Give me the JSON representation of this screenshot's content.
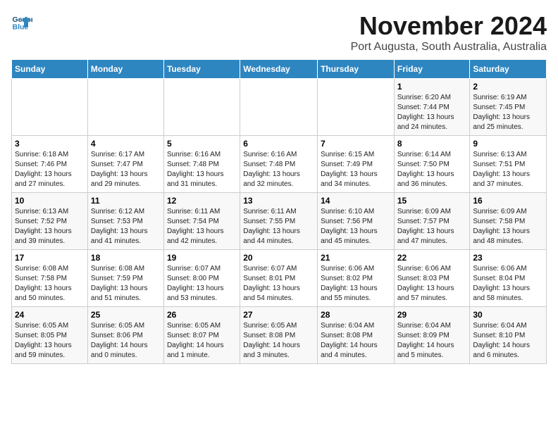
{
  "header": {
    "logo_line1": "General",
    "logo_line2": "Blue",
    "title": "November 2024",
    "subtitle": "Port Augusta, South Australia, Australia"
  },
  "weekdays": [
    "Sunday",
    "Monday",
    "Tuesday",
    "Wednesday",
    "Thursday",
    "Friday",
    "Saturday"
  ],
  "weeks": [
    [
      {
        "day": "",
        "info": ""
      },
      {
        "day": "",
        "info": ""
      },
      {
        "day": "",
        "info": ""
      },
      {
        "day": "",
        "info": ""
      },
      {
        "day": "",
        "info": ""
      },
      {
        "day": "1",
        "info": "Sunrise: 6:20 AM\nSunset: 7:44 PM\nDaylight: 13 hours\nand 24 minutes."
      },
      {
        "day": "2",
        "info": "Sunrise: 6:19 AM\nSunset: 7:45 PM\nDaylight: 13 hours\nand 25 minutes."
      }
    ],
    [
      {
        "day": "3",
        "info": "Sunrise: 6:18 AM\nSunset: 7:46 PM\nDaylight: 13 hours\nand 27 minutes."
      },
      {
        "day": "4",
        "info": "Sunrise: 6:17 AM\nSunset: 7:47 PM\nDaylight: 13 hours\nand 29 minutes."
      },
      {
        "day": "5",
        "info": "Sunrise: 6:16 AM\nSunset: 7:48 PM\nDaylight: 13 hours\nand 31 minutes."
      },
      {
        "day": "6",
        "info": "Sunrise: 6:16 AM\nSunset: 7:48 PM\nDaylight: 13 hours\nand 32 minutes."
      },
      {
        "day": "7",
        "info": "Sunrise: 6:15 AM\nSunset: 7:49 PM\nDaylight: 13 hours\nand 34 minutes."
      },
      {
        "day": "8",
        "info": "Sunrise: 6:14 AM\nSunset: 7:50 PM\nDaylight: 13 hours\nand 36 minutes."
      },
      {
        "day": "9",
        "info": "Sunrise: 6:13 AM\nSunset: 7:51 PM\nDaylight: 13 hours\nand 37 minutes."
      }
    ],
    [
      {
        "day": "10",
        "info": "Sunrise: 6:13 AM\nSunset: 7:52 PM\nDaylight: 13 hours\nand 39 minutes."
      },
      {
        "day": "11",
        "info": "Sunrise: 6:12 AM\nSunset: 7:53 PM\nDaylight: 13 hours\nand 41 minutes."
      },
      {
        "day": "12",
        "info": "Sunrise: 6:11 AM\nSunset: 7:54 PM\nDaylight: 13 hours\nand 42 minutes."
      },
      {
        "day": "13",
        "info": "Sunrise: 6:11 AM\nSunset: 7:55 PM\nDaylight: 13 hours\nand 44 minutes."
      },
      {
        "day": "14",
        "info": "Sunrise: 6:10 AM\nSunset: 7:56 PM\nDaylight: 13 hours\nand 45 minutes."
      },
      {
        "day": "15",
        "info": "Sunrise: 6:09 AM\nSunset: 7:57 PM\nDaylight: 13 hours\nand 47 minutes."
      },
      {
        "day": "16",
        "info": "Sunrise: 6:09 AM\nSunset: 7:58 PM\nDaylight: 13 hours\nand 48 minutes."
      }
    ],
    [
      {
        "day": "17",
        "info": "Sunrise: 6:08 AM\nSunset: 7:58 PM\nDaylight: 13 hours\nand 50 minutes."
      },
      {
        "day": "18",
        "info": "Sunrise: 6:08 AM\nSunset: 7:59 PM\nDaylight: 13 hours\nand 51 minutes."
      },
      {
        "day": "19",
        "info": "Sunrise: 6:07 AM\nSunset: 8:00 PM\nDaylight: 13 hours\nand 53 minutes."
      },
      {
        "day": "20",
        "info": "Sunrise: 6:07 AM\nSunset: 8:01 PM\nDaylight: 13 hours\nand 54 minutes."
      },
      {
        "day": "21",
        "info": "Sunrise: 6:06 AM\nSunset: 8:02 PM\nDaylight: 13 hours\nand 55 minutes."
      },
      {
        "day": "22",
        "info": "Sunrise: 6:06 AM\nSunset: 8:03 PM\nDaylight: 13 hours\nand 57 minutes."
      },
      {
        "day": "23",
        "info": "Sunrise: 6:06 AM\nSunset: 8:04 PM\nDaylight: 13 hours\nand 58 minutes."
      }
    ],
    [
      {
        "day": "24",
        "info": "Sunrise: 6:05 AM\nSunset: 8:05 PM\nDaylight: 13 hours\nand 59 minutes."
      },
      {
        "day": "25",
        "info": "Sunrise: 6:05 AM\nSunset: 8:06 PM\nDaylight: 14 hours\nand 0 minutes."
      },
      {
        "day": "26",
        "info": "Sunrise: 6:05 AM\nSunset: 8:07 PM\nDaylight: 14 hours\nand 1 minute."
      },
      {
        "day": "27",
        "info": "Sunrise: 6:05 AM\nSunset: 8:08 PM\nDaylight: 14 hours\nand 3 minutes."
      },
      {
        "day": "28",
        "info": "Sunrise: 6:04 AM\nSunset: 8:08 PM\nDaylight: 14 hours\nand 4 minutes."
      },
      {
        "day": "29",
        "info": "Sunrise: 6:04 AM\nSunset: 8:09 PM\nDaylight: 14 hours\nand 5 minutes."
      },
      {
        "day": "30",
        "info": "Sunrise: 6:04 AM\nSunset: 8:10 PM\nDaylight: 14 hours\nand 6 minutes."
      }
    ]
  ]
}
